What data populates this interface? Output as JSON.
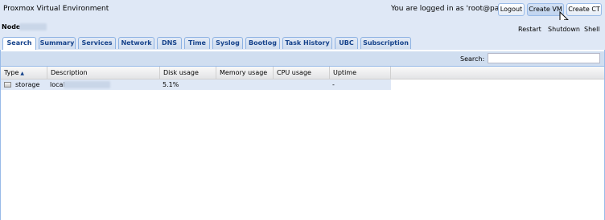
{
  "header": {
    "app_title": "Proxmox Virtual Environment",
    "login_message": "You are logged in as 'root@pam'",
    "logout_label": "Logout",
    "create_vm_label": "Create VM",
    "create_ct_label": "Create CT"
  },
  "node": {
    "label": "Node",
    "actions": {
      "restart": "Restart",
      "shutdown": "Shutdown",
      "shell": "Shell"
    }
  },
  "tabs": [
    {
      "label": "Search",
      "active": true
    },
    {
      "label": "Summary",
      "active": false
    },
    {
      "label": "Services",
      "active": false
    },
    {
      "label": "Network",
      "active": false
    },
    {
      "label": "DNS",
      "active": false
    },
    {
      "label": "Time",
      "active": false
    },
    {
      "label": "Syslog",
      "active": false
    },
    {
      "label": "Bootlog",
      "active": false
    },
    {
      "label": "Task History",
      "active": false
    },
    {
      "label": "UBC",
      "active": false
    },
    {
      "label": "Subscription",
      "active": false
    }
  ],
  "search": {
    "label": "Search:",
    "value": ""
  },
  "grid": {
    "columns": [
      {
        "label": "Type",
        "sorted": "asc"
      },
      {
        "label": "Description"
      },
      {
        "label": "Disk usage"
      },
      {
        "label": "Memory usage"
      },
      {
        "label": "CPU usage"
      },
      {
        "label": "Uptime"
      }
    ],
    "rows": [
      {
        "type": "storage",
        "icon": "storage-icon",
        "description": "local",
        "disk_usage": "5.1%",
        "memory_usage": "",
        "cpu_usage": "",
        "uptime": "-"
      }
    ]
  },
  "colors": {
    "panel_bg": "#dfe8f6",
    "border": "#99bbe8",
    "tab_text": "#15428b",
    "selected_row": "#dfe8f6"
  }
}
